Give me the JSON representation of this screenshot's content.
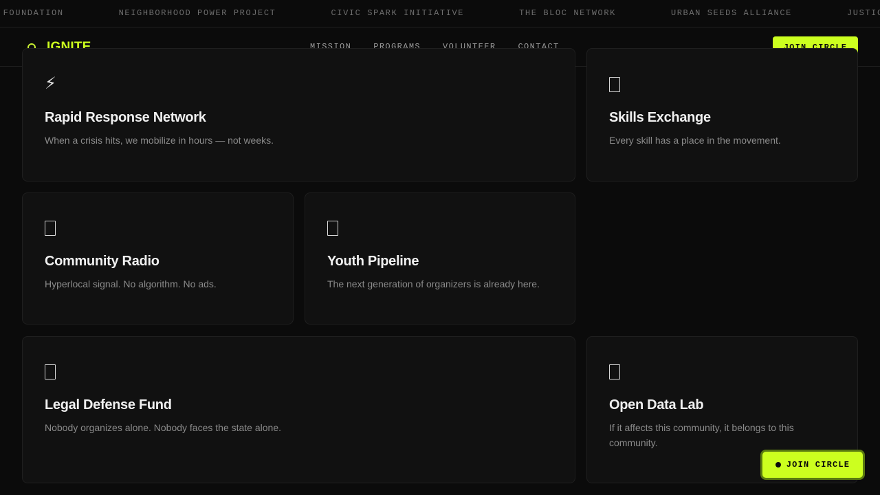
{
  "ticker": {
    "items": [
      "S FOUNDATION",
      "NEIGHBORHOOD POWER PROJECT",
      "CIVIC SPARK INITIATIVE",
      "THE BLOC NETWORK",
      "URBAN SEEDS ALLIANCE",
      "JUSTICE F"
    ]
  },
  "header": {
    "brand": "IGNITE",
    "nav": [
      "MISSION",
      "PROGRAMS",
      "VOLUNTEER",
      "CONTACT"
    ],
    "cta": "JOIN CIRCLE"
  },
  "programs": [
    {
      "icon": "lightning-icon",
      "icon_glyph": "⚡",
      "title": "Rapid Response Network",
      "desc": "When a crisis hits, we mobilize in hours — not weeks."
    },
    {
      "icon": "placeholder-icon",
      "icon_glyph": "",
      "title": "Skills Exchange",
      "desc": "Every skill has a place in the movement."
    },
    {
      "icon": "placeholder-icon",
      "icon_glyph": "",
      "title": "Community Radio",
      "desc": "Hyperlocal signal. No algorithm. No ads."
    },
    {
      "icon": "placeholder-icon",
      "icon_glyph": "",
      "title": "Youth Pipeline",
      "desc": "The next generation of organizers is already here."
    },
    {
      "icon": "placeholder-icon",
      "icon_glyph": "",
      "title": "Legal Defense Fund",
      "desc": "Nobody organizes alone. Nobody faces the state alone."
    },
    {
      "icon": "placeholder-icon",
      "icon_glyph": "",
      "title": "Open Data Lab",
      "desc": "If it affects this community, it belongs to this community."
    }
  ],
  "floating_cta": "JOIN CIRCLE",
  "colors": {
    "accent": "#ccff1f",
    "background": "#0b0b0b",
    "card": "#111111"
  }
}
